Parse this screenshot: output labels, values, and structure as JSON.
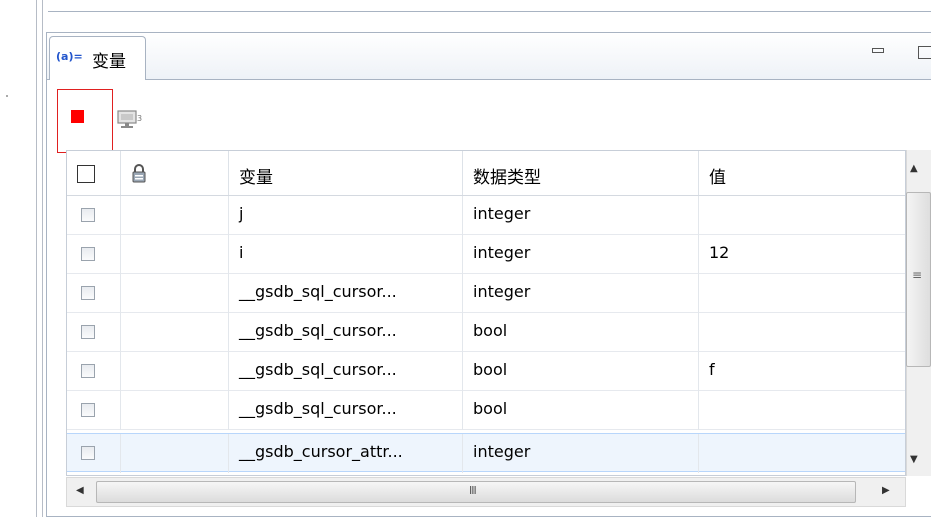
{
  "view": {
    "tab_icon": "(a)=",
    "tab_label": "变量"
  },
  "toolbar": {
    "stop_icon": "stop-icon",
    "monitor_icon": "display-variables-icon"
  },
  "table": {
    "columns": [
      "",
      "",
      "变量",
      "数据类型",
      "值"
    ],
    "rows": [
      {
        "name": "j",
        "type": "integer",
        "value": ""
      },
      {
        "name": "i",
        "type": "integer",
        "value": "12"
      },
      {
        "name": "__gsdb_sql_cursor...",
        "type": "integer",
        "value": ""
      },
      {
        "name": "__gsdb_sql_cursor...",
        "type": "bool",
        "value": ""
      },
      {
        "name": "__gsdb_sql_cursor...",
        "type": "bool",
        "value": "f"
      },
      {
        "name": "__gsdb_sql_cursor...",
        "type": "bool",
        "value": ""
      },
      {
        "name": "__gsdb_cursor_attr...",
        "type": "integer",
        "value": ""
      }
    ]
  },
  "scrollbar": {
    "v_grip": "≡",
    "h_grip": "III",
    "up": "▲",
    "down": "▼",
    "left": "◀",
    "right": "▶"
  },
  "colors": {
    "stop": "#ff0000",
    "highlight_border": "#e02020",
    "selected_row": "#eef5fd",
    "tab_icon": "#2255cc"
  }
}
